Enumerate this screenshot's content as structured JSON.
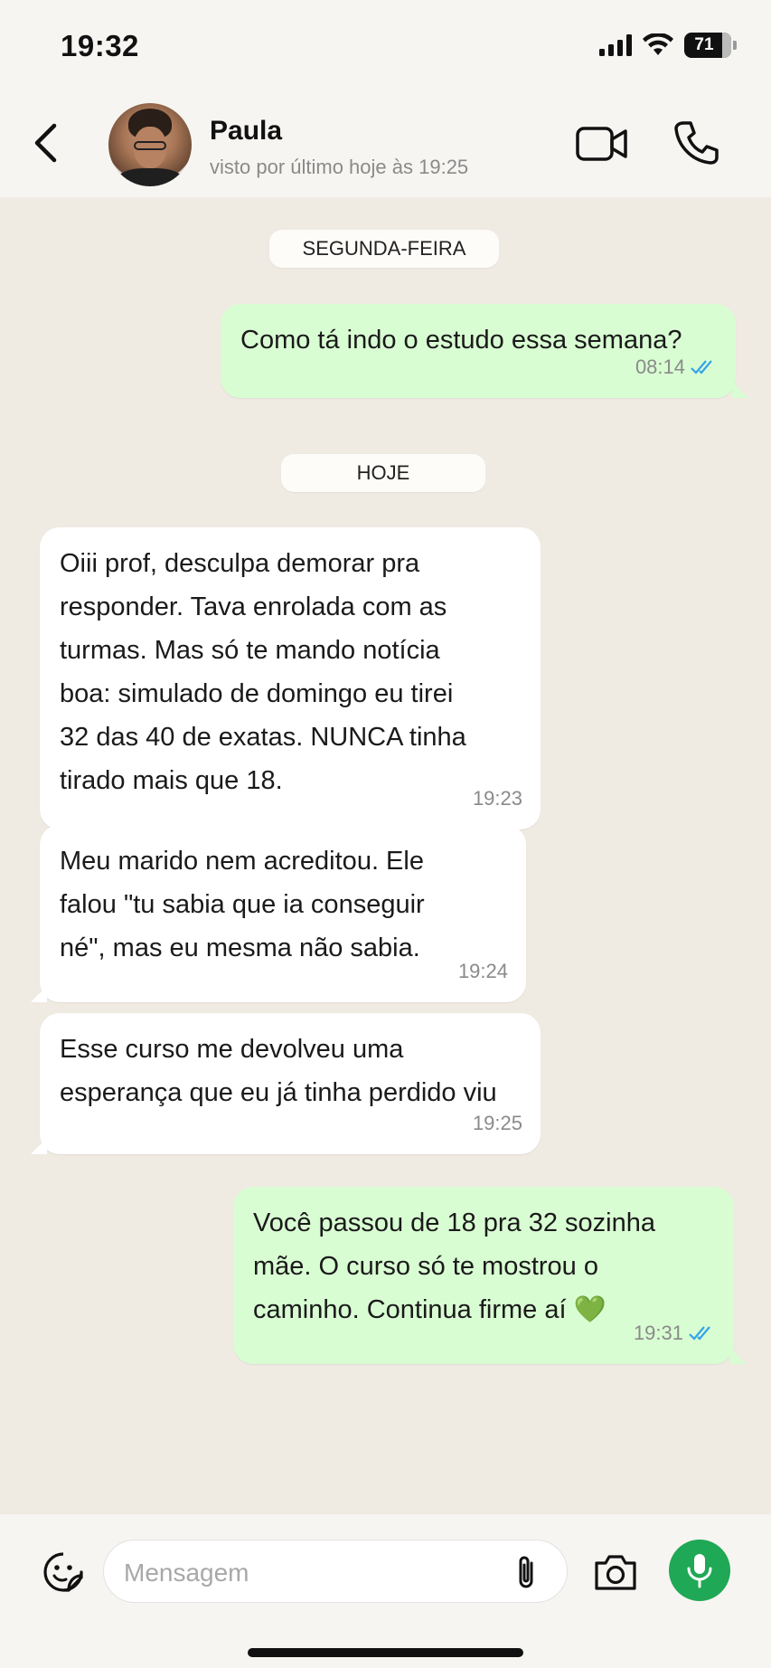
{
  "status_bar": {
    "time": "19:32",
    "battery": "71",
    "icons": [
      "signal-icon",
      "wifi-icon",
      "battery-icon"
    ]
  },
  "header": {
    "contact_name": "Paula",
    "last_seen": "visto por último hoje às 19:25",
    "icons": [
      "back-arrow-icon",
      "avatar",
      "video-call-icon",
      "phone-icon"
    ]
  },
  "chat": {
    "date_1": "SEGUNDA-FEIRA",
    "date_2": "HOJE",
    "messages": [
      {
        "direction": "out",
        "text": "Como tá indo o estudo essa semana?",
        "time": "08:14",
        "read": true
      },
      {
        "direction": "in",
        "text": "Oiii prof, desculpa demorar pra\nresponder. Tava enrolada com as\nturmas. Mas só te mando notícia\nboa: simulado de domingo eu tirei\n32 das 40 de exatas. NUNCA tinha\ntirado mais que 18.",
        "time": "19:23"
      },
      {
        "direction": "in",
        "text": "Meu marido nem acreditou. Ele\nfalou \"tu sabia que ia conseguir\nné\", mas eu mesma não sabia.",
        "time": "19:24"
      },
      {
        "direction": "in",
        "text": "Esse curso me devolveu uma\nesperança que eu já tinha perdido viu",
        "time": "19:25"
      },
      {
        "direction": "out",
        "text": "Você passou de 18 pra 32 sozinha\nmãe. O curso só te mostrou o\ncaminho. Continua firme aí 💚",
        "time": "19:31",
        "read": true
      }
    ]
  },
  "input_bar": {
    "placeholder": "Mensagem",
    "icons": [
      "sticker-icon",
      "attach-icon",
      "camera-icon",
      "mic-icon"
    ]
  },
  "colors": {
    "chat_bg": "#efeae2",
    "out_bubble": "#d9fdd3",
    "in_bubble": "#ffffff",
    "read_ticks": "#34a3e8",
    "mic_button": "#1fa855"
  }
}
